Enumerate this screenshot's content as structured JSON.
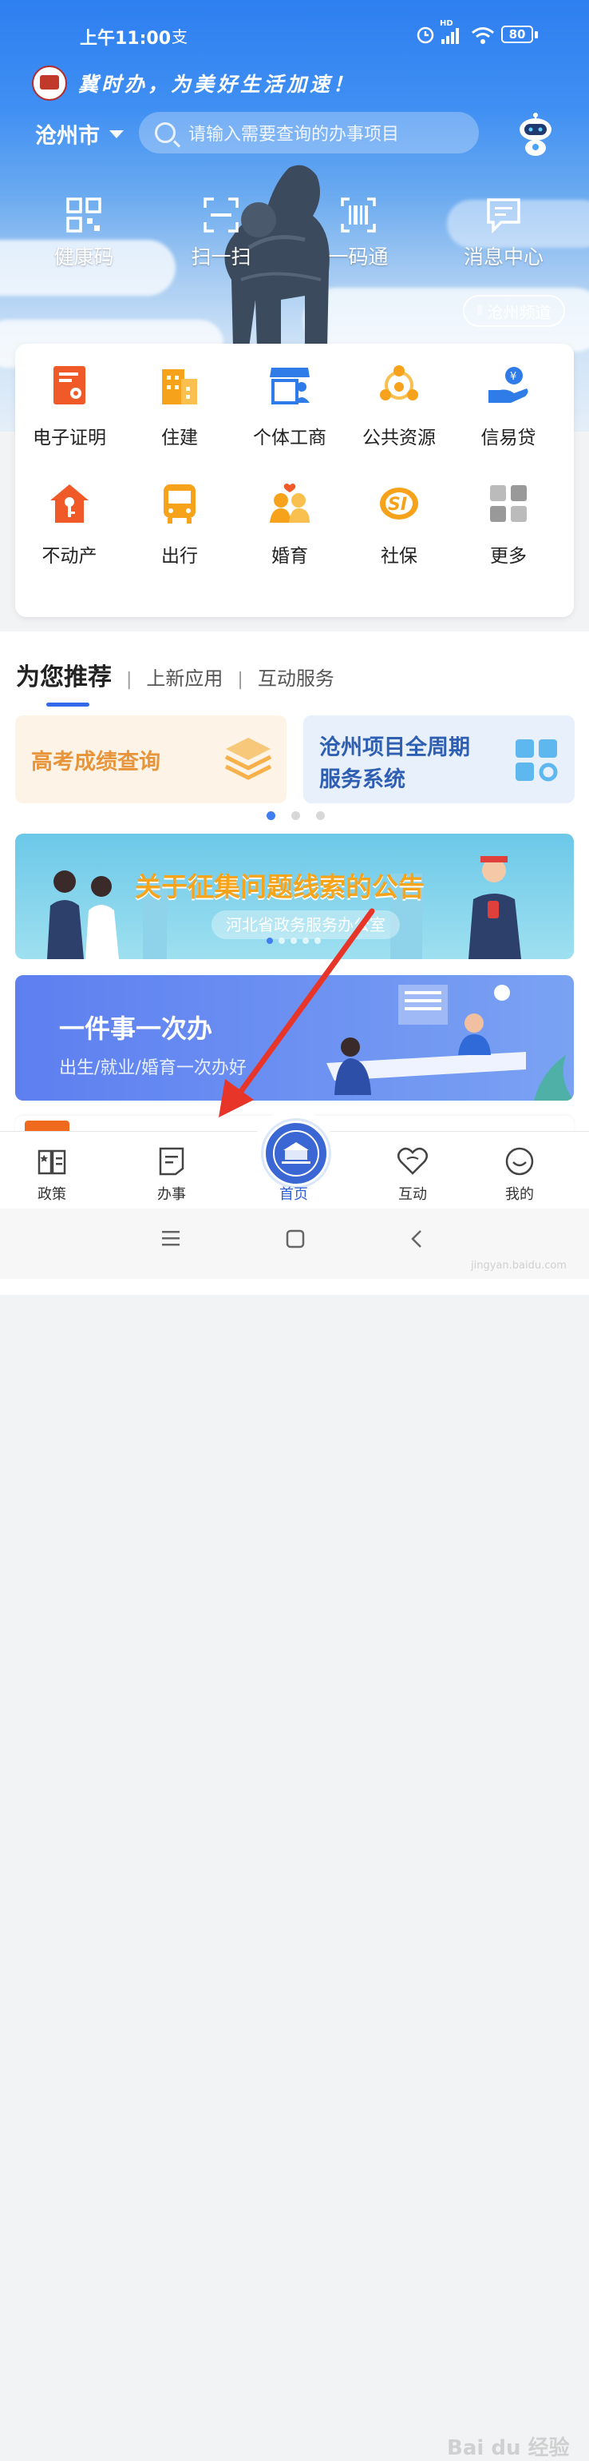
{
  "status_bar": {
    "time": "上午11:00",
    "carrier_glyph": "支",
    "hd": "HD",
    "battery": "80"
  },
  "slogan": "冀时办，为美好生活加速！",
  "city": "沧州市",
  "search": {
    "placeholder": "请输入需要查询的办事项目"
  },
  "quick_actions": [
    {
      "label": "健康码",
      "icon": "qr-grid-icon"
    },
    {
      "label": "扫一扫",
      "icon": "scan-icon"
    },
    {
      "label": "一码通",
      "icon": "barcode-icon"
    },
    {
      "label": "消息中心",
      "icon": "message-icon"
    }
  ],
  "channel_button": "沧州频道",
  "services": [
    {
      "label": "电子证明",
      "icon": "certificate-icon",
      "color": "#f05a28"
    },
    {
      "label": "住建",
      "icon": "building-icon",
      "color": "#f7a21b"
    },
    {
      "label": "个体工商",
      "icon": "store-icon",
      "color": "#2f7be8"
    },
    {
      "label": "公共资源",
      "icon": "network-icon",
      "color": "#f7a21b"
    },
    {
      "label": "信易贷",
      "icon": "loan-hand-icon",
      "color": "#2f7be8"
    },
    {
      "label": "不动产",
      "icon": "house-key-icon",
      "color": "#f05a28"
    },
    {
      "label": "出行",
      "icon": "bus-icon",
      "color": "#f7a21b"
    },
    {
      "label": "婚育",
      "icon": "couple-icon",
      "color": "#f7a21b"
    },
    {
      "label": "社保",
      "icon": "social-security-icon",
      "color": "#f7a21b"
    },
    {
      "label": "更多",
      "icon": "more-grid-icon",
      "color": "#aaaaaa"
    }
  ],
  "recommend_tabs": {
    "active": "为您推荐",
    "tab2": "上新应用",
    "tab3": "互动服务"
  },
  "recommend_cards": [
    {
      "title": "高考成绩查询",
      "color": "#e8943a"
    },
    {
      "title_line1": "沧州项目全周期",
      "title_line2": "服务系统",
      "color": "#2f5fb3"
    }
  ],
  "banners": [
    {
      "title": "关于征集问题线索的公告",
      "subtitle": "河北省政务服务办公室"
    },
    {
      "title": "一件事一次办",
      "subtitle": "出生/就业/婚育一次办好"
    }
  ],
  "tabbar": [
    {
      "label": "政策",
      "icon": "policy-book-icon"
    },
    {
      "label": "办事",
      "icon": "document-icon"
    },
    {
      "label": "首页",
      "icon": "home-emblem-icon"
    },
    {
      "label": "互动",
      "icon": "heart-icon"
    },
    {
      "label": "我的",
      "icon": "smile-face-icon"
    }
  ],
  "watermark": "Bai du 经验",
  "watermark_sub": "jingyan.baidu.com"
}
